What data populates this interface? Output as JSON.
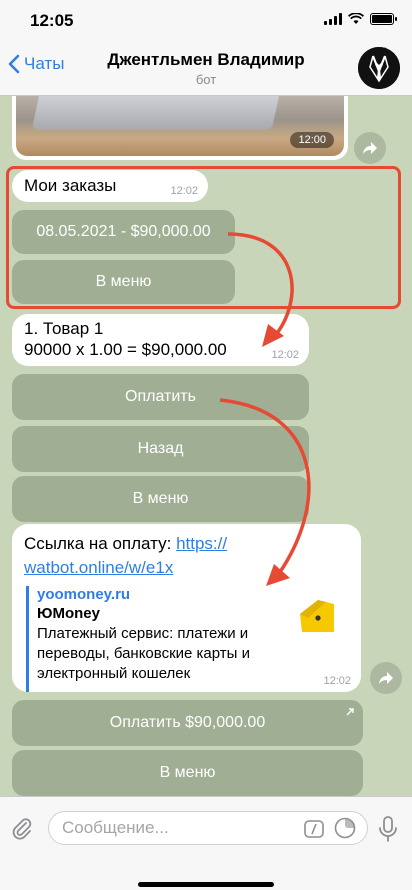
{
  "status": {
    "time": "12:05"
  },
  "header": {
    "back_label": "Чаты",
    "title": "Джентльмен Владимир",
    "subtitle": "бот"
  },
  "messages": {
    "photo_time": "12:00",
    "orders": {
      "text": "Мои заказы",
      "time": "12:02",
      "buttons": [
        "08.05.2021 - $90,000.00",
        "В меню"
      ]
    },
    "item": {
      "line1": "1. Товар 1",
      "line2": "90000 x 1.00 = $90,000.00",
      "time": "12:02",
      "buttons": [
        "Оплатить",
        "Назад",
        "В меню"
      ]
    },
    "payment": {
      "text": "Ссылка на оплату: ",
      "link_part1": "https://",
      "link_part2": "watbot.online/w/e1x",
      "preview_site": "yoomoney.ru",
      "preview_title": "ЮMoney",
      "preview_desc": "Платежный сервис: платежи и переводы, банковские карты и электронный кошелек",
      "time": "12:02",
      "buttons": [
        "Оплатить $90,000.00",
        "В меню"
      ]
    }
  },
  "input": {
    "placeholder": "Сообщение..."
  },
  "colors": {
    "accent": "#2f7ee6",
    "annotation": "#e64a35"
  }
}
